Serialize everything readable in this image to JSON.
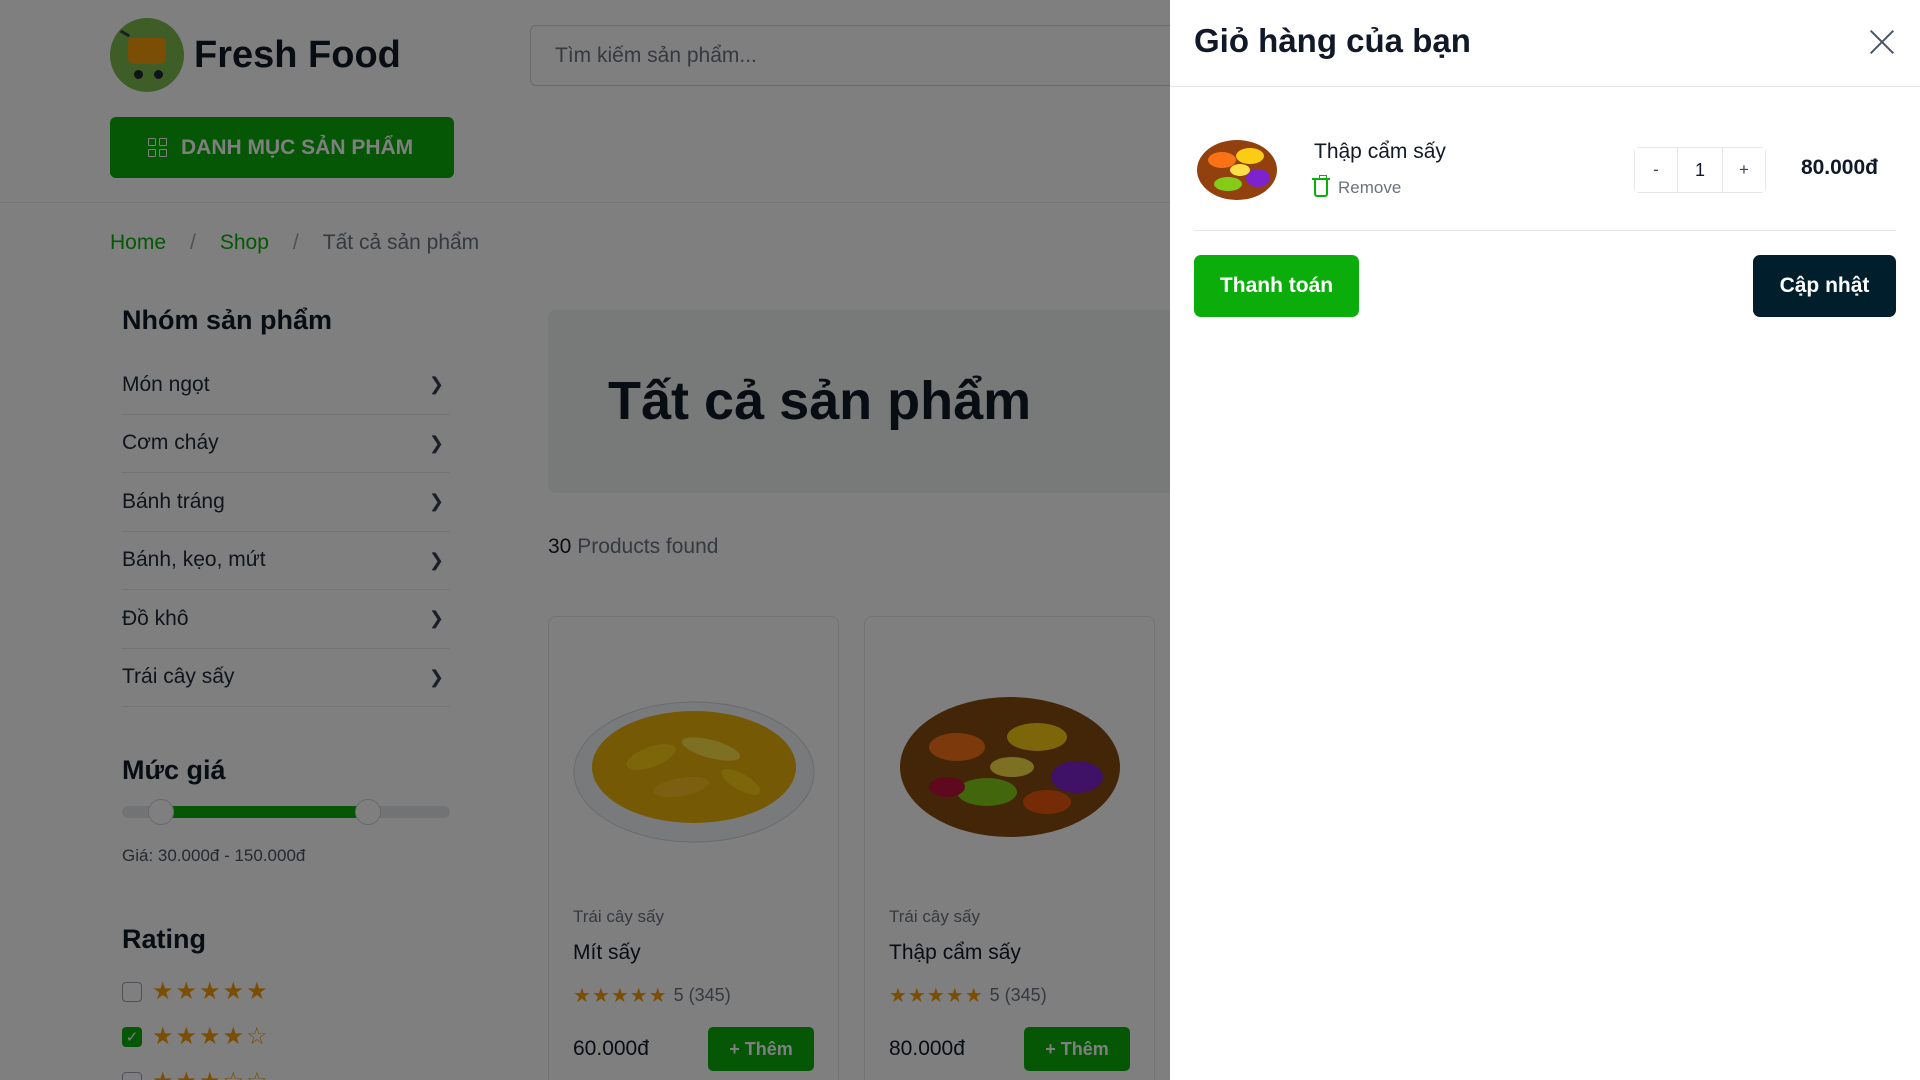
{
  "header": {
    "logo_text": "Fresh Food",
    "search_placeholder": "Tìm kiếm sản phẩm...",
    "category_button": "DANH MỤC SẢN PHẨM"
  },
  "breadcrumb": {
    "home": "Home",
    "shop": "Shop",
    "current": "Tất cả sản phẩm",
    "separator": "/"
  },
  "sidebar": {
    "groups_title": "Nhóm sản phẩm",
    "categories": [
      "Món ngọt",
      "Cơm cháy",
      "Bánh tráng",
      "Bánh, kẹo, mứt",
      "Đồ khô",
      "Trái cây sấy"
    ],
    "price_title": "Mức giá",
    "price_text": "Giá: 30.000đ - 150.000đ",
    "price_range": {
      "min_fraction": 0.12,
      "max_fraction": 0.75
    },
    "rating_title": "Rating",
    "rating_rows": [
      {
        "stars": 5,
        "checked": false
      },
      {
        "stars": 4,
        "checked": true
      },
      {
        "stars": 3,
        "checked": false
      }
    ]
  },
  "main": {
    "banner_title": "Tất cả sản phẩm",
    "found_count": "30",
    "found_label": "Products found",
    "products": [
      {
        "category": "Trái cây sấy",
        "name": "Mít sấy",
        "rating": "5 (345)",
        "price": "60.000đ",
        "add_label": "Thêm"
      },
      {
        "category": "Trái cây sấy",
        "name": "Thập cẩm sấy",
        "rating": "5 (345)",
        "price": "80.000đ",
        "add_label": "Thêm"
      }
    ]
  },
  "cart": {
    "title": "Giỏ hàng của bạn",
    "items": [
      {
        "name": "Thập cẩm sấy",
        "remove_label": "Remove",
        "qty": "1",
        "minus": "-",
        "plus": "+",
        "total": "80.000đ"
      }
    ],
    "checkout_label": "Thanh toán",
    "update_label": "Cập nhật"
  },
  "colors": {
    "brand_green": "#0aad0a",
    "dark_button": "#001e2b",
    "star": "#f59e0b",
    "overlay": "rgba(0,0,0,0.5)"
  }
}
